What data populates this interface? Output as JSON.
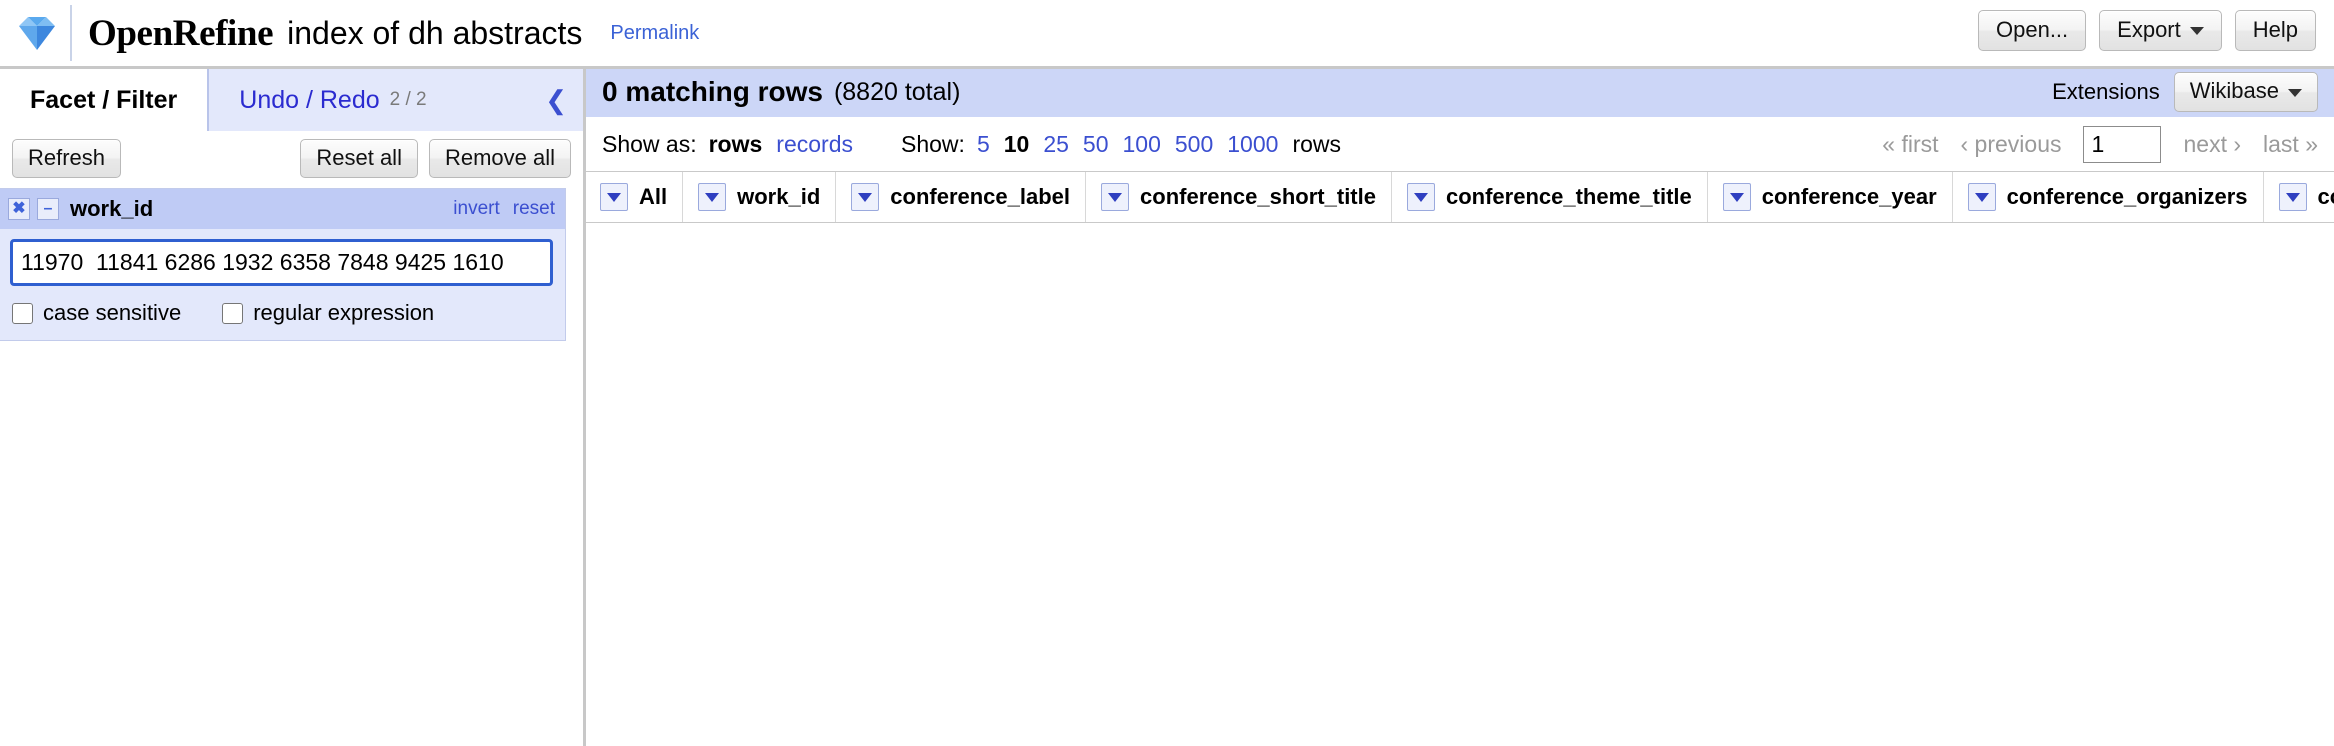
{
  "header": {
    "logo_icon": "diamond-icon",
    "product_title": "OpenRefine",
    "project_name": "index of dh abstracts",
    "permalink_label": "Permalink",
    "buttons": [
      {
        "label": "Open...",
        "has_caret": false
      },
      {
        "label": "Export",
        "has_caret": true
      },
      {
        "label": "Help",
        "has_caret": false
      }
    ]
  },
  "left_panel": {
    "tabs": [
      {
        "label": "Facet / Filter",
        "active": true,
        "count": ""
      },
      {
        "label": "Undo / Redo",
        "active": false,
        "count": "2 / 2"
      }
    ],
    "collapse_icon": "chevron-left-icon",
    "toolbar": {
      "refresh_label": "Refresh",
      "reset_all_label": "Reset all",
      "remove_all_label": "Remove all"
    },
    "facets": [
      {
        "remove_icon": "close-icon",
        "minimize_icon": "minimize-icon",
        "name": "work_id",
        "invert_label": "invert",
        "reset_label": "reset",
        "text_value": "11970  11841 6286 1932 6358 7848 9425 1610",
        "case_sensitive_label": "case sensitive",
        "case_sensitive_checked": false,
        "regex_label": "regular expression",
        "regex_checked": false
      }
    ]
  },
  "right_panel": {
    "summary": {
      "matching_rows": "0 matching rows",
      "total": "(8820 total)",
      "extensions_label": "Extensions",
      "extensions_button": "Wikibase",
      "extensions_caret": true
    },
    "controls": {
      "show_as_label": "Show as:",
      "show_as_options": [
        {
          "label": "rows",
          "selected": true
        },
        {
          "label": "records",
          "selected": false
        }
      ],
      "show_label": "Show:",
      "show_options": [
        {
          "label": "5",
          "selected": false
        },
        {
          "label": "10",
          "selected": true
        },
        {
          "label": "25",
          "selected": false
        },
        {
          "label": "50",
          "selected": false
        },
        {
          "label": "100",
          "selected": false
        },
        {
          "label": "500",
          "selected": false
        },
        {
          "label": "1000",
          "selected": false
        }
      ],
      "rows_suffix": "rows"
    },
    "pager": {
      "first_label": "« first",
      "previous_label": "‹ previous",
      "page_value": "1",
      "next_label": "next ›",
      "last_label": "last »"
    },
    "columns": [
      {
        "title": "All",
        "dropdown_icon": "chevron-down-icon"
      },
      {
        "title": "work_id",
        "dropdown_icon": "chevron-down-icon"
      },
      {
        "title": "conference_label",
        "dropdown_icon": "chevron-down-icon"
      },
      {
        "title": "conference_short_title",
        "dropdown_icon": "chevron-down-icon"
      },
      {
        "title": "conference_theme_title",
        "dropdown_icon": "chevron-down-icon"
      },
      {
        "title": "conference_year",
        "dropdown_icon": "chevron-down-icon"
      },
      {
        "title": "conference_organizers",
        "dropdown_icon": "chevron-down-icon"
      },
      {
        "title": "confe",
        "dropdown_icon": "chevron-down-icon"
      }
    ],
    "rows": []
  }
}
